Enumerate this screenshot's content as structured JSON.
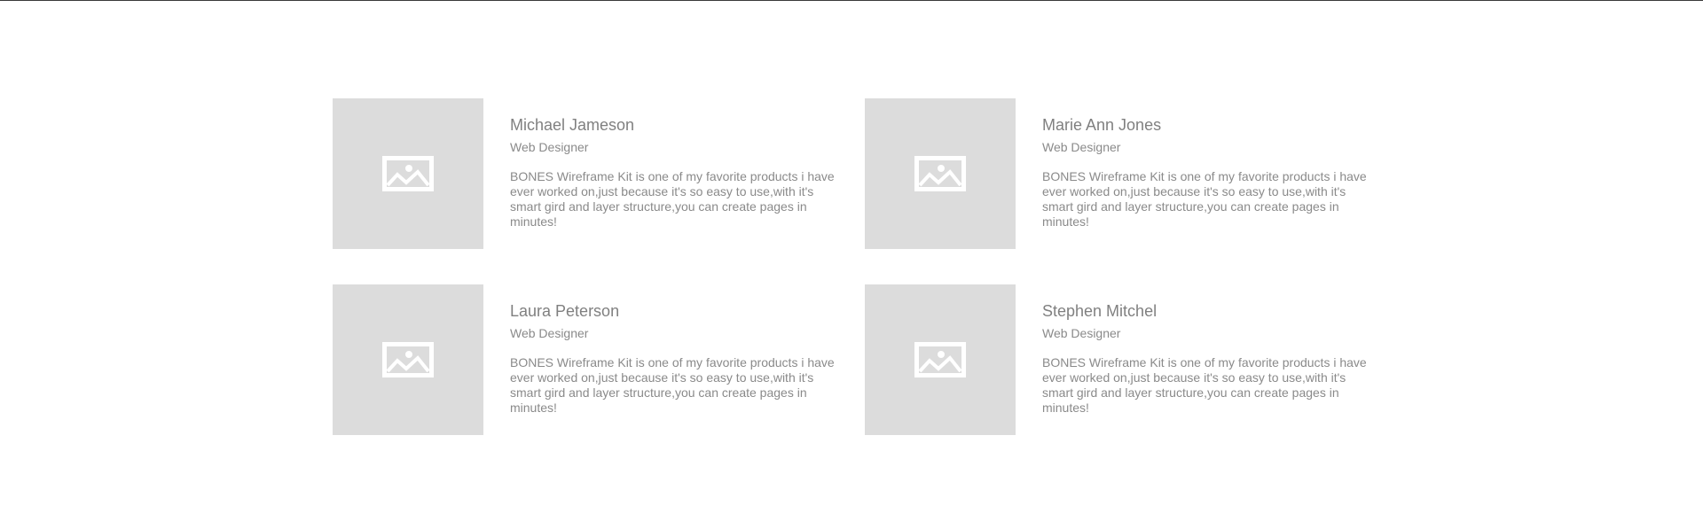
{
  "colors": {
    "rule": "#3a3a3a",
    "placeholder_bg": "#dcdcdc",
    "placeholder_icon": "#ffffff",
    "text": "#8a8a8a"
  },
  "team": [
    {
      "name": "Michael Jameson",
      "role": "Web Designer",
      "quote": "BONES Wireframe Kit is one of my favorite products i have ever worked on,just because it's so easy to use,with it's smart gird and layer structure,you can create pages in minutes!",
      "image_icon": "image-placeholder-icon"
    },
    {
      "name": "Marie Ann Jones",
      "role": "Web Designer",
      "quote": "BONES Wireframe Kit is one of my favorite products i have ever worked on,just because it's so easy to use,with it's smart gird and layer structure,you can create pages in minutes!",
      "image_icon": "image-placeholder-icon"
    },
    {
      "name": "Laura Peterson",
      "role": "Web Designer",
      "quote": "BONES Wireframe Kit is one of my favorite products i have ever worked on,just because it's so easy to use,with it's smart gird and layer structure,you can create pages in minutes!",
      "image_icon": "image-placeholder-icon"
    },
    {
      "name": "Stephen Mitchel",
      "role": "Web Designer",
      "quote": "BONES Wireframe Kit is one of my favorite products i have ever worked on,just because it's so easy to use,with it's smart gird and layer structure,you can create pages in minutes!",
      "image_icon": "image-placeholder-icon"
    }
  ]
}
